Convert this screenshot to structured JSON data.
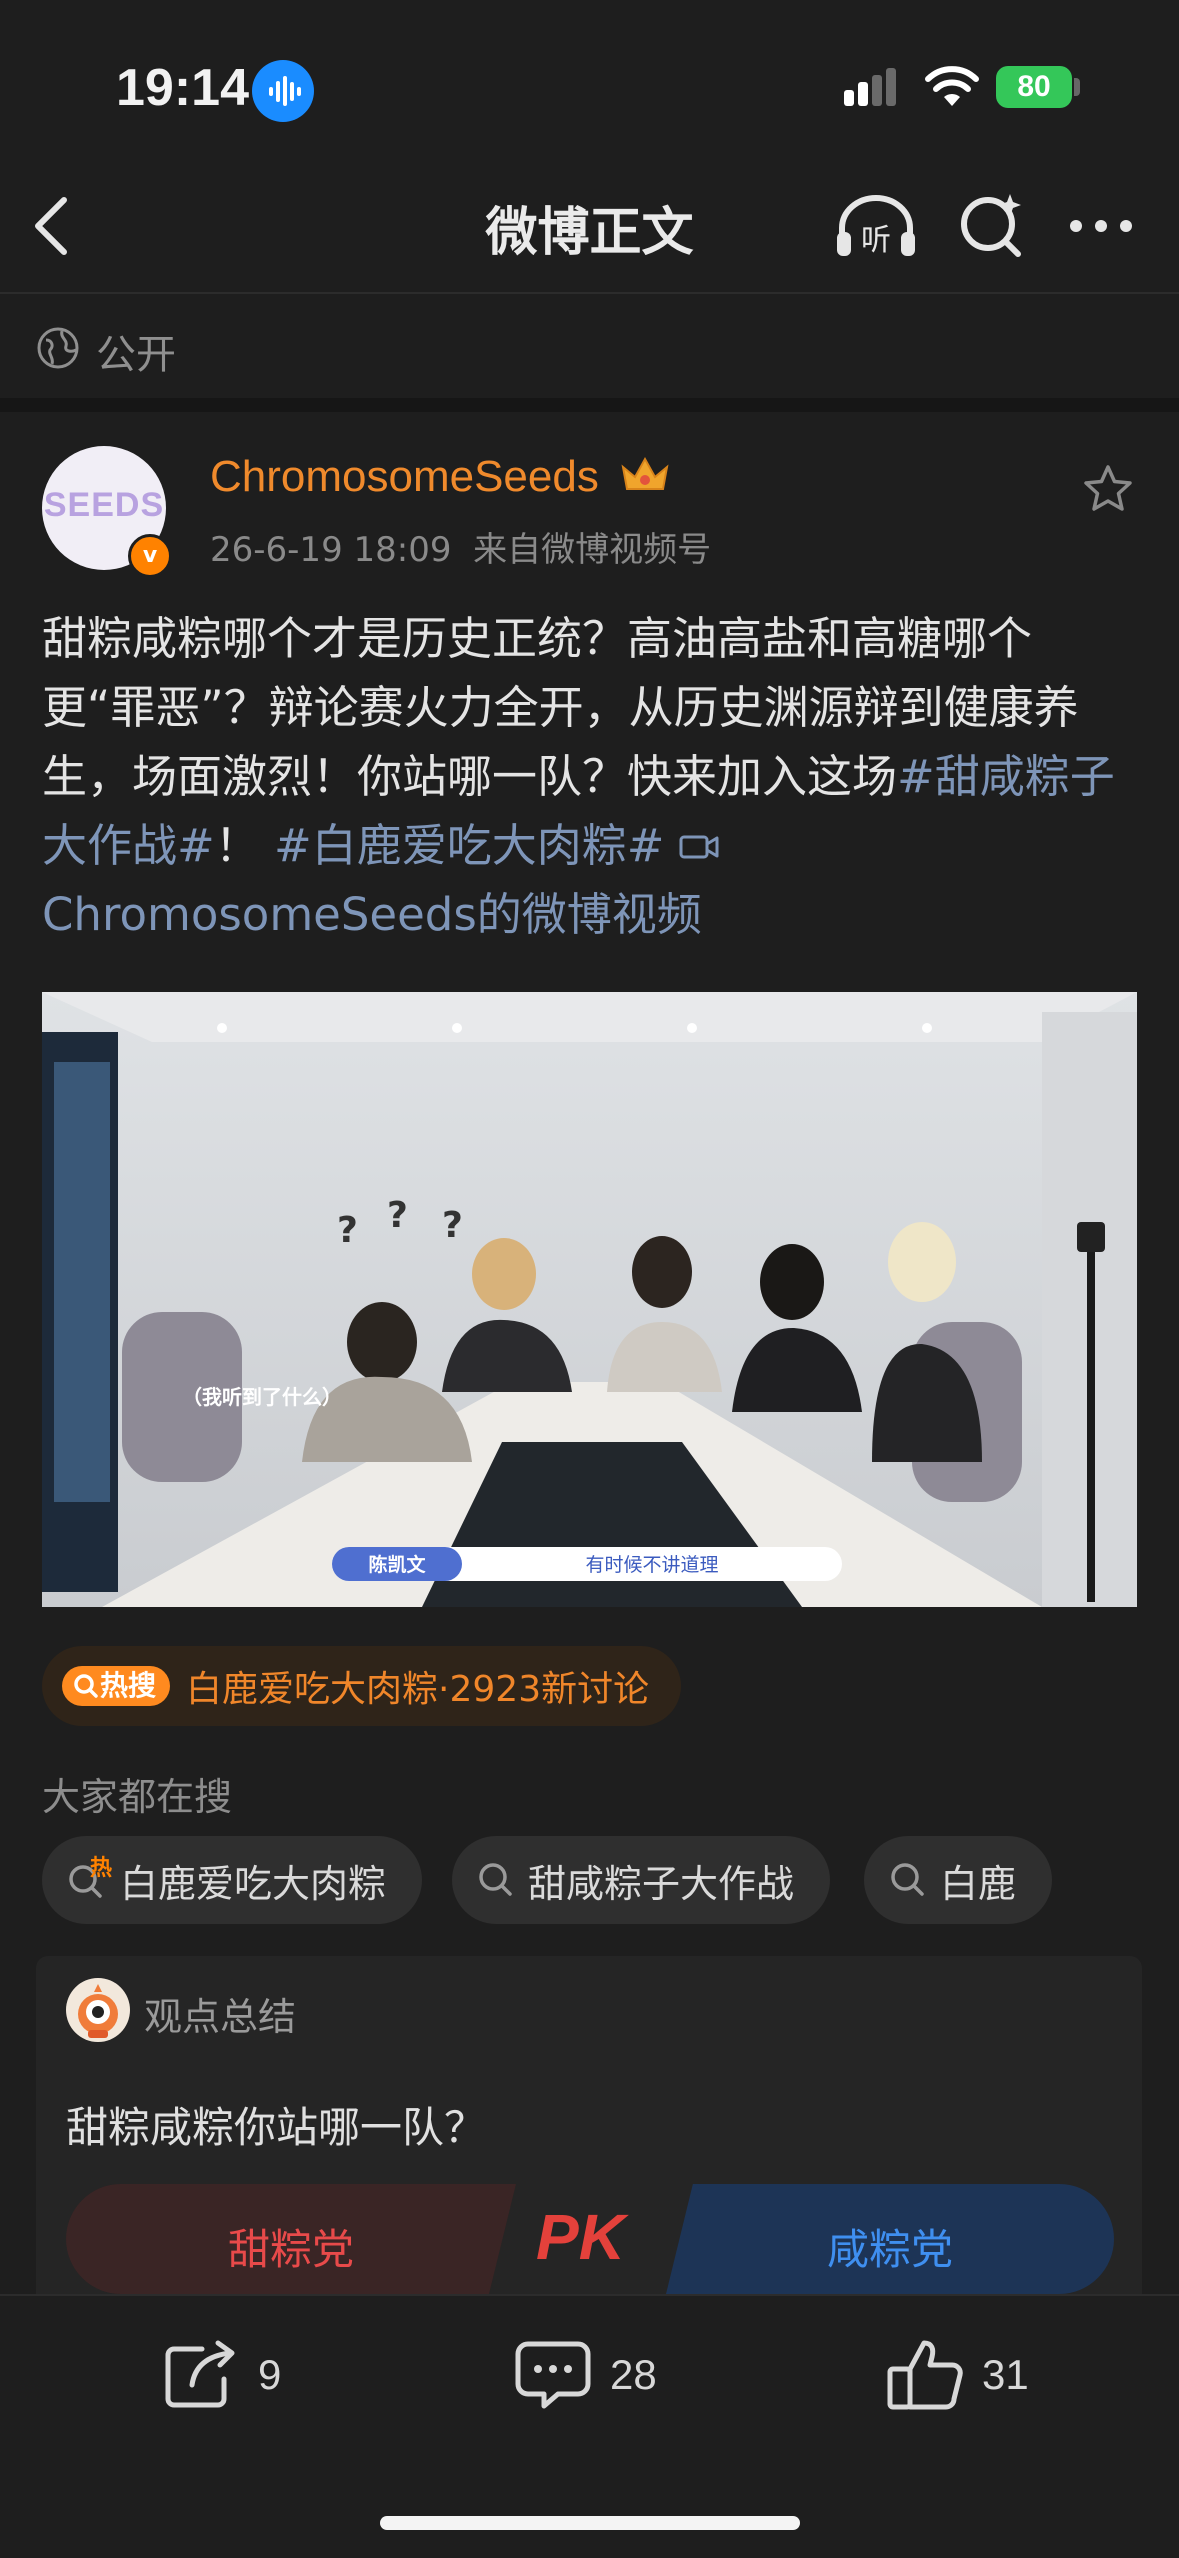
{
  "status_bar": {
    "time": "19:14",
    "battery": "80"
  },
  "nav": {
    "title": "微博正文"
  },
  "visibility": {
    "label": "公开"
  },
  "post": {
    "author": "ChromosomeSeeds",
    "avatar_text": "SEEDS",
    "verified_mark": "v",
    "timestamp": "26-6-19 18:09",
    "source": "来自微博视频号",
    "text_part1": "甜粽咸粽哪个才是历史正统？高油高盐和高糖哪个更“罪恶”？辩论赛火力全开，从历史渊源辩到健康养生，场面激烈！你站哪一队？快来加入这场",
    "tag1": "#甜咸粽子大作战#",
    "text_part2": "！",
    "tag2": "#白鹿爱吃大肉粽#",
    "video_link": "ChromosomeSeeds的微博视频"
  },
  "video": {
    "bubble_text": "（我听到了什么）",
    "caption_name": "陈凯文",
    "caption_text": "有时候不讲道理"
  },
  "hot_search": {
    "badge": "热搜",
    "topic": "白鹿爱吃大肉粽",
    "count": "·2923新讨论"
  },
  "others_searching": {
    "label": "大家都在搜",
    "hot_mark": "热",
    "chips": [
      "白鹿爱吃大肉粽",
      "甜咸粽子大作战",
      "白鹿"
    ]
  },
  "summary": {
    "title": "观点总结",
    "question": "甜粽咸粽你站哪一队？",
    "left": "甜粽党",
    "pk": "PK",
    "right": "咸粽党"
  },
  "actions": {
    "share_count": "9",
    "comment_count": "28",
    "like_count": "31"
  },
  "colors": {
    "accent_orange": "#ff8200",
    "tag_blue": "#7e95b8",
    "background": "#1e1e1e"
  }
}
